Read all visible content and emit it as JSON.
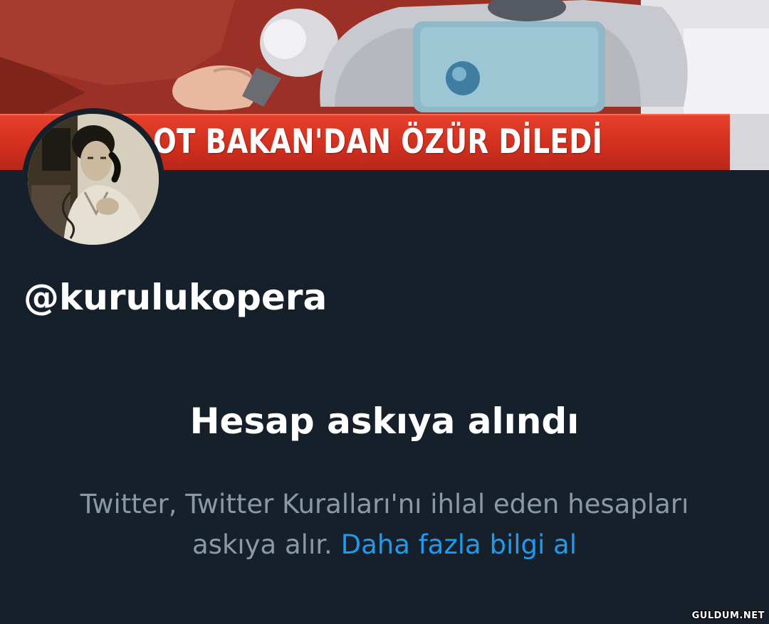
{
  "banner": {
    "headline": "OT BAKAN'DAN ÖZÜR DİLEDİ"
  },
  "profile": {
    "handle": "@kurulukopera"
  },
  "suspension": {
    "title": "Hesap askıya alındı",
    "body": "Twitter, Twitter Kuralları'nı ihlal eden hesapları askıya alır.",
    "link_label": "Daha fazla bilgi al"
  },
  "watermark": "GULDUM.NET",
  "colors": {
    "background": "#15202b",
    "primary_text": "#ffffff",
    "secondary_text": "#8b98a5",
    "link": "#1d9bf0",
    "news_strip": "#d12f1f"
  }
}
